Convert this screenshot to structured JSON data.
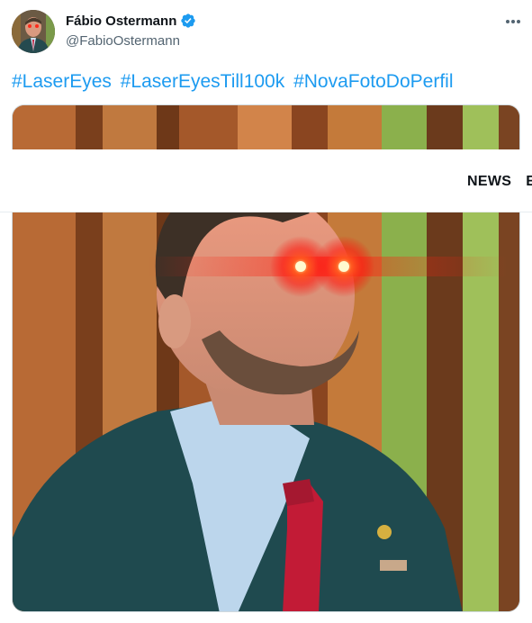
{
  "tweet": {
    "display_name": "Fábio Ostermann",
    "handle": "@FabioOstermann",
    "verified_icon": "verified-badge-icon",
    "more_icon": "more-horizontal-icon",
    "hashtags": [
      "#LaserEyes",
      "#LaserEyesTill100k",
      "#NovaFotoDoPerfil"
    ],
    "accent_color": "#1d9bf0"
  },
  "overlay": {
    "nav_items": [
      "NEWS",
      "E"
    ]
  }
}
